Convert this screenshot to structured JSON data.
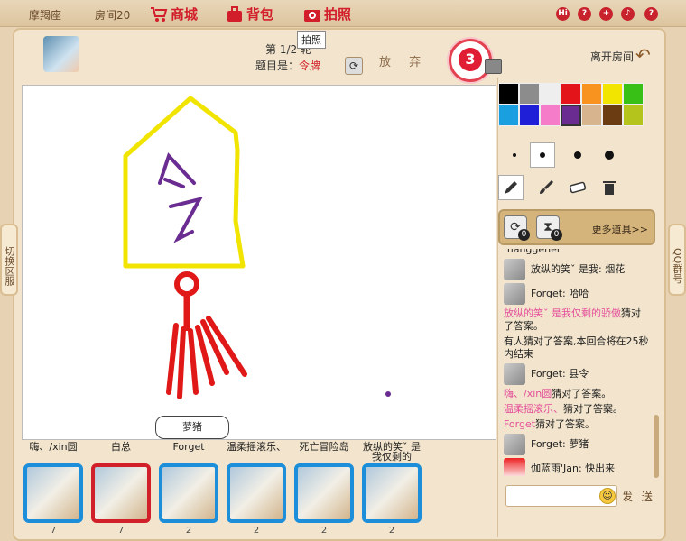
{
  "topbar": {
    "constellation": "摩羯座",
    "room": "房间20",
    "shop": "商城",
    "bag": "背包",
    "photo": "拍照",
    "tooltip": "拍照"
  },
  "game": {
    "round": "第 1/2 轮",
    "topic_label": "题目是：",
    "topic_answer": "令牌",
    "give_up": "放 弃",
    "timer": "3",
    "leave": "离开房间"
  },
  "side_tabs": {
    "left": "切换区服",
    "right": "QQ群号"
  },
  "palette": [
    "#000000",
    "#8c8c8c",
    "#eeeeee",
    "#e4141b",
    "#f7931e",
    "#f2e600",
    "#39c017",
    "#1a9fe0",
    "#1f1fd8",
    "#f57cc8",
    "#6a2c91",
    "#d8b48e",
    "#6b3c12",
    "#b4c41c"
  ],
  "props": {
    "eraser_all_count": "0",
    "hourglass_count": "0",
    "more": "更多道具>>"
  },
  "chat": [
    {
      "type": "cut",
      "text": "manggener"
    },
    {
      "type": "msg",
      "avatar": "gray",
      "text": "放纵的笑ˇ 是我: 烟花"
    },
    {
      "type": "msg",
      "avatar": "gray",
      "text": "Forget: 哈哈"
    },
    {
      "type": "sys",
      "pink": "放纵的笑ˇ 是我仅剩的骄傲",
      "text": "猜对了答案。"
    },
    {
      "type": "sys",
      "pink": "",
      "text": "有人猜对了答案,本回合将在25秒内结束"
    },
    {
      "type": "msg",
      "avatar": "gray",
      "text": "Forget: 县令"
    },
    {
      "type": "sys",
      "pink": "嗨、/xin圆",
      "text": "猜对了答案。"
    },
    {
      "type": "sys",
      "pink": "温柔摇滚乐、",
      "text": "猜对了答案。"
    },
    {
      "type": "sys",
      "pink": "Forget",
      "text": "猜对了答案。"
    },
    {
      "type": "msg",
      "avatar": "gray",
      "text": "Forget: 萝猪"
    },
    {
      "type": "msg",
      "avatar": "red",
      "text": "伽蓝雨'Jan: 快出来"
    }
  ],
  "send": "发 送",
  "bubble": "萝猪",
  "players": [
    {
      "name": "嗨、/xin圆",
      "score": "7",
      "border": "blue"
    },
    {
      "name": "白总",
      "score": "7",
      "border": "red"
    },
    {
      "name": "Forget",
      "score": "2",
      "border": "blue"
    },
    {
      "name": "温柔摇滚乐、",
      "score": "2",
      "border": "blue"
    },
    {
      "name": "死亡冒险岛",
      "score": "2",
      "border": "blue"
    },
    {
      "name": "放纵的笑ˇ 是我仅剩的",
      "score": "2",
      "border": "blue"
    }
  ]
}
